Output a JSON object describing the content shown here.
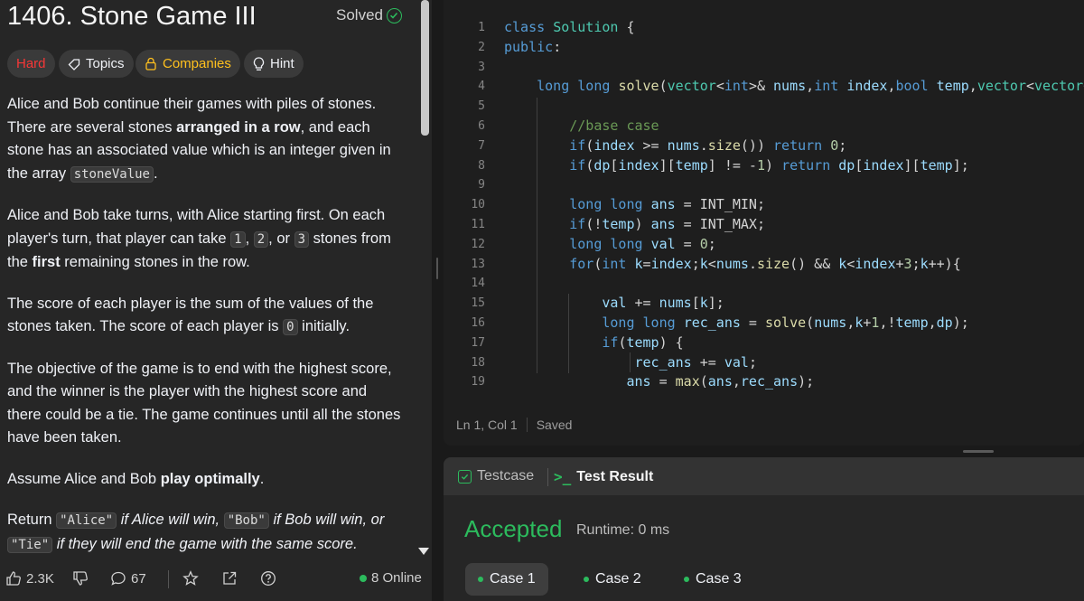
{
  "problem": {
    "title": "1406. Stone Game III",
    "solved_label": "Solved",
    "difficulty": "Hard",
    "topics_label": "Topics",
    "companies_label": "Companies",
    "hint_label": "Hint",
    "p1_a": "Alice and Bob continue their games with piles of stones. There are several stones ",
    "p1_b": "arranged in a row",
    "p1_c": ", and each stone has an associated value which is an integer given in the array ",
    "p1_code": "stoneValue",
    "p1_d": ".",
    "p2_a": "Alice and Bob take turns, with Alice starting first. On each player's turn, that player can take ",
    "p2_n1": "1",
    "p2_comma1": ", ",
    "p2_n2": "2",
    "p2_or": ", or ",
    "p2_n3": "3",
    "p2_b": " stones from the ",
    "p2_first": "first",
    "p2_c": " remaining stones in the row.",
    "p3_a": "The score of each player is the sum of the values of the stones taken. The score of each player is ",
    "p3_code": "0",
    "p3_b": " initially.",
    "p4": "The objective of the game is to end with the highest score, and the winner is the player with the highest score and there could be a tie. The game continues until all the stones have been taken.",
    "p5_a": "Assume Alice and Bob ",
    "p5_b": "play optimally",
    "p5_c": ".",
    "p6_a": "Return ",
    "p6_alice": "\"Alice\"",
    "p6_b": " if Alice will win, ",
    "p6_bob": "\"Bob\"",
    "p6_c": " if Bob will win, or ",
    "p6_tie": "\"Tie\"",
    "p6_d": " if they will end the game with the same score."
  },
  "footer": {
    "likes": "2.3K",
    "comments": "67",
    "online": "8 Online"
  },
  "editor": {
    "line_numbers": [
      "1",
      "2",
      "3",
      "4",
      "5",
      "6",
      "7",
      "8",
      "9",
      "10",
      "11",
      "12",
      "13",
      "14",
      "15",
      "16",
      "17",
      "18",
      "19"
    ],
    "status_position": "Ln 1, Col 1",
    "status_saved": "Saved"
  },
  "results": {
    "testcase_tab": "Testcase",
    "result_tab": "Test Result",
    "prompt_glyph": ">_",
    "verdict": "Accepted",
    "runtime": "Runtime: 0 ms",
    "cases": [
      "Case 1",
      "Case 2",
      "Case 3"
    ]
  },
  "colors": {
    "accent_green": "#2cbb5d",
    "hard_red": "#f63737",
    "companies_gold": "#ffc01e"
  }
}
